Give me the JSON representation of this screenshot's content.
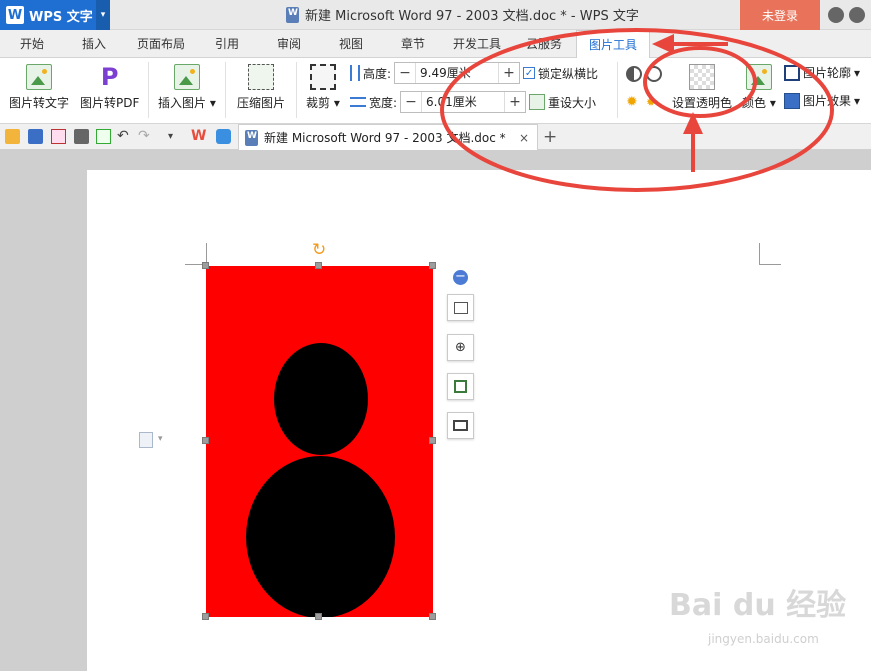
{
  "titlebar": {
    "app_name": "WPS 文字",
    "drop_icon": "dropdown-arrow",
    "doc_title": "新建 Microsoft Word 97 - 2003 文档.doc * - WPS 文字",
    "login": "未登录"
  },
  "tabs": [
    "开始",
    "插入",
    "页面布局",
    "引用",
    "审阅",
    "视图",
    "章节",
    "开发工具",
    "云服务",
    "图片工具"
  ],
  "active_tab": "图片工具",
  "ribbon": {
    "img_to_text": "图片转文字",
    "img_to_pdf": "图片转PDF",
    "insert_image": "插入图片",
    "compress": "压缩图片",
    "crop": "裁剪",
    "height_label": "高度:",
    "height_value": "9.49厘米",
    "width_label": "宽度:",
    "width_value": "6.01厘米",
    "lock_ratio": "锁定纵横比",
    "reset_size": "重设大小",
    "set_transparent": "设置透明色",
    "color": "颜色",
    "outline": "图片轮廓",
    "effect": "图片效果"
  },
  "doc_tab": {
    "title": "新建 Microsoft Word 97 - 2003 文档.doc *",
    "close": "×",
    "add": "+"
  },
  "watermark": {
    "brand": "Bai du 经验",
    "url": "jingyen.baidu.com"
  },
  "colors": {
    "accent": "#1f6fd3",
    "annotation": "#e8463c",
    "picture_bg": "#ff0000"
  }
}
